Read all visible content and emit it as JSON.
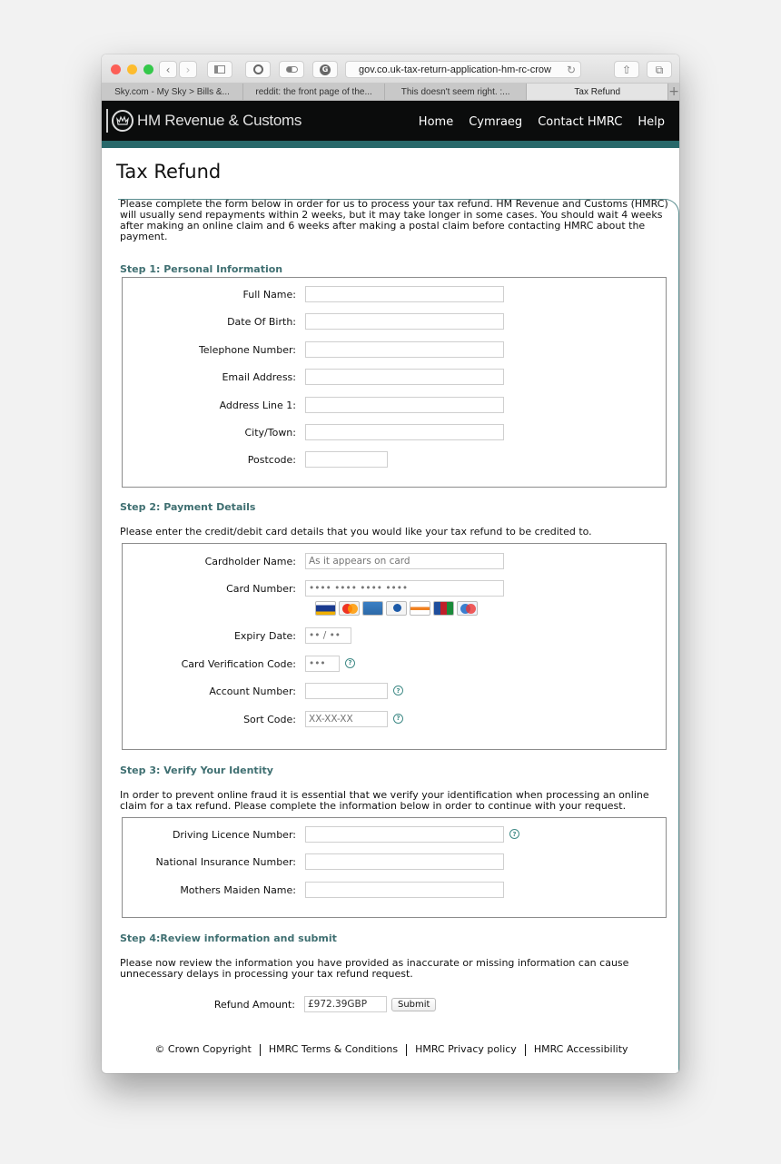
{
  "browser": {
    "url": "gov.co.uk-tax-return-application-hm-rc-crow",
    "tabs": [
      {
        "label": "Sky.com - My Sky > Bills &...",
        "active": false
      },
      {
        "label": "reddit: the front page of the...",
        "active": false
      },
      {
        "label": "This doesn't seem right. :...",
        "active": false
      },
      {
        "label": "Tax Refund",
        "active": true
      }
    ],
    "new_tab_label": "+"
  },
  "header": {
    "brand": "HM Revenue & Customs",
    "nav": [
      "Home",
      "Cymraeg",
      "Contact HMRC",
      "Help"
    ],
    "accent_color": "#28686a"
  },
  "page": {
    "title": "Tax Refund",
    "intro": "Please complete the form below in order for us to process your tax refund. HM Revenue and Customs (HMRC) will usually send repayments within 2 weeks, but it may take longer in some cases. You should wait 4 weeks after making an online claim and 6 weeks after making a postal claim before contacting HMRC about the payment."
  },
  "step1": {
    "title": "Step 1: Personal Information",
    "fields": [
      {
        "label": "Full Name:",
        "value": "",
        "placeholder": ""
      },
      {
        "label": "Date Of Birth:",
        "value": "",
        "placeholder": ""
      },
      {
        "label": "Telephone Number:",
        "value": "",
        "placeholder": ""
      },
      {
        "label": "Email Address:",
        "value": "",
        "placeholder": ""
      },
      {
        "label": "Address Line 1:",
        "value": "",
        "placeholder": ""
      },
      {
        "label": "City/Town:",
        "value": "",
        "placeholder": ""
      },
      {
        "label": "Postcode:",
        "value": "",
        "placeholder": ""
      }
    ]
  },
  "step2": {
    "title": "Step 2: Payment Details",
    "text": "Please enter the credit/debit card details that you would like your tax refund to be credited to.",
    "cardholder": {
      "label": "Cardholder Name:",
      "placeholder": "As it appears on card"
    },
    "card_number": {
      "label": "Card Number:",
      "placeholder": "•••• •••• •••• ••••"
    },
    "card_logos": [
      "visa-icon",
      "mastercard-icon",
      "amex-icon",
      "diners-club-icon",
      "discover-icon",
      "jcb-icon",
      "maestro-icon"
    ],
    "expiry": {
      "label": "Expiry Date:",
      "placeholder": "•• / ••"
    },
    "cvc": {
      "label": "Card Verification Code:",
      "placeholder": "•••"
    },
    "account": {
      "label": "Account Number:",
      "placeholder": ""
    },
    "sort_code": {
      "label": "Sort Code:",
      "placeholder": "XX-XX-XX"
    },
    "help_glyph": "?"
  },
  "step3": {
    "title": "Step 3: Verify Your Identity",
    "text": "In order to prevent online fraud it is essential that we verify your identification when processing an online claim for a tax refund. Please complete the information below in order to continue with your request.",
    "fields": [
      {
        "label": "Driving Licence Number:",
        "value": ""
      },
      {
        "label": "National Insurance Number:",
        "value": ""
      },
      {
        "label": "Mothers Maiden Name:",
        "value": ""
      }
    ]
  },
  "step4": {
    "title": "Step 4:Review information and submit",
    "text": "Please now review the information you have provided as inaccurate or missing information can cause unnecessary delays in processing your tax refund request.",
    "refund_label": "Refund Amount:",
    "refund_value": "£972.39GBP",
    "submit_label": "Submit"
  },
  "footer": {
    "links": [
      "© Crown Copyright",
      "HMRC Terms & Conditions",
      "HMRC Privacy policy",
      "HMRC Accessibility"
    ]
  }
}
